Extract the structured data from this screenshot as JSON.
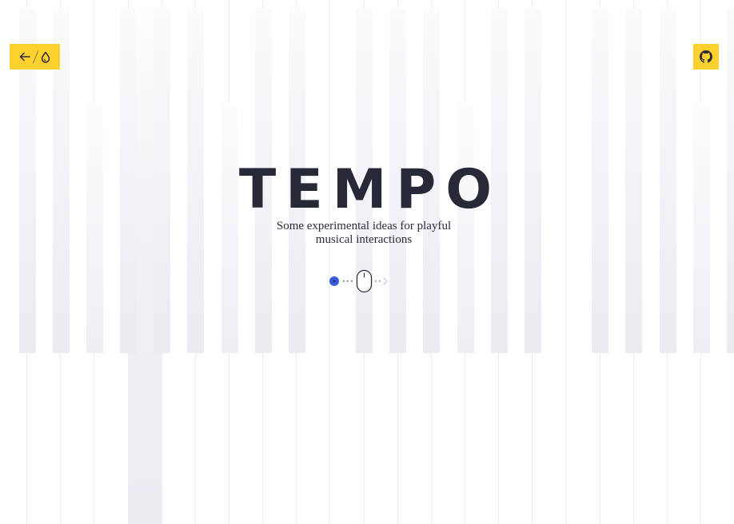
{
  "page": {
    "title": "TEMPO",
    "subtitle": "Some experimental ideas for playful musical interactions"
  },
  "nav": {
    "back_icon": "arrow-left-icon",
    "theme_icon": "drop-icon",
    "github_icon": "github-icon"
  },
  "scroll_hint": {
    "icons": [
      "dot-indicator-icon",
      "mouse-icon",
      "chevron-right-icon"
    ]
  },
  "keyboard": {
    "white_key_count": 22,
    "active_white_key_index": 4,
    "black_keys": [
      0,
      1,
      3,
      4,
      5,
      7,
      8,
      10,
      11,
      12,
      14,
      15,
      17,
      18,
      19,
      21
    ]
  },
  "colors": {
    "accent": "#ffd12e",
    "text": "#272938",
    "indicator": "#3a5bd6",
    "key_shade": "#ececf3"
  }
}
